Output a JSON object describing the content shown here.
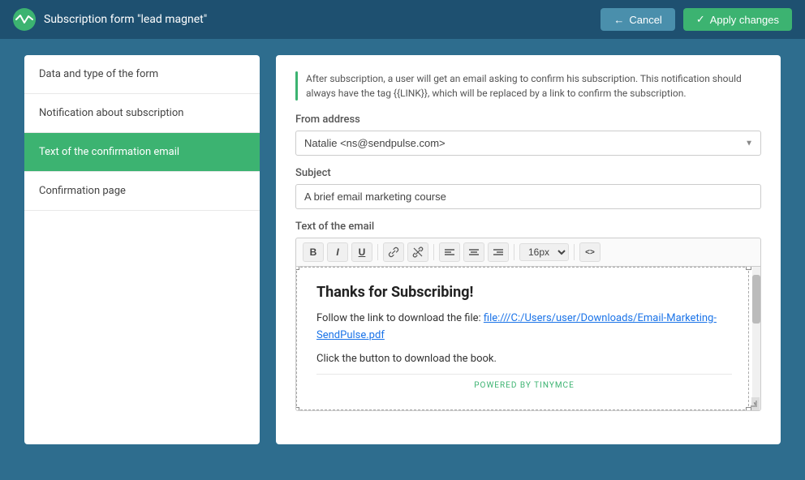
{
  "topbar": {
    "title": "Subscription form \"lead magnet\"",
    "cancel_label": "Cancel",
    "apply_label": "Apply changes"
  },
  "sidebar": {
    "items": [
      {
        "id": "data-type",
        "label": "Data and type of the form",
        "active": false
      },
      {
        "id": "notification",
        "label": "Notification about subscription",
        "active": false
      },
      {
        "id": "confirmation-email",
        "label": "Text of the confirmation email",
        "active": true
      },
      {
        "id": "confirmation-page",
        "label": "Confirmation page",
        "active": false
      }
    ]
  },
  "panel": {
    "info_text": "After subscription, a user will get an email asking to confirm his subscription. This notification should always have the tag {{LINK}}, which will be replaced by a link to confirm the subscription.",
    "from_address_label": "From address",
    "from_address_value": "Natalie <ns@sendpulse.com>",
    "subject_label": "Subject",
    "subject_value": "A brief email marketing course",
    "email_text_label": "Text of the email",
    "editor": {
      "toolbar": {
        "bold": "B",
        "italic": "I",
        "underline": "U",
        "link": "🔗",
        "unlink": "✂",
        "align_left": "≡",
        "align_center": "≡",
        "align_right": "≡",
        "font_size": "16px",
        "code": "<>"
      },
      "content": {
        "heading": "Thanks for Subscribing!",
        "body_line1": "Follow the link to download the file: ",
        "link_text": "file:///C:/Users/user/Downloads/Email-Marketing-SendPulse.pdf",
        "body_line2": "Click the button to download the book.",
        "powered_by": "POWERED BY TINYMCE"
      }
    }
  }
}
